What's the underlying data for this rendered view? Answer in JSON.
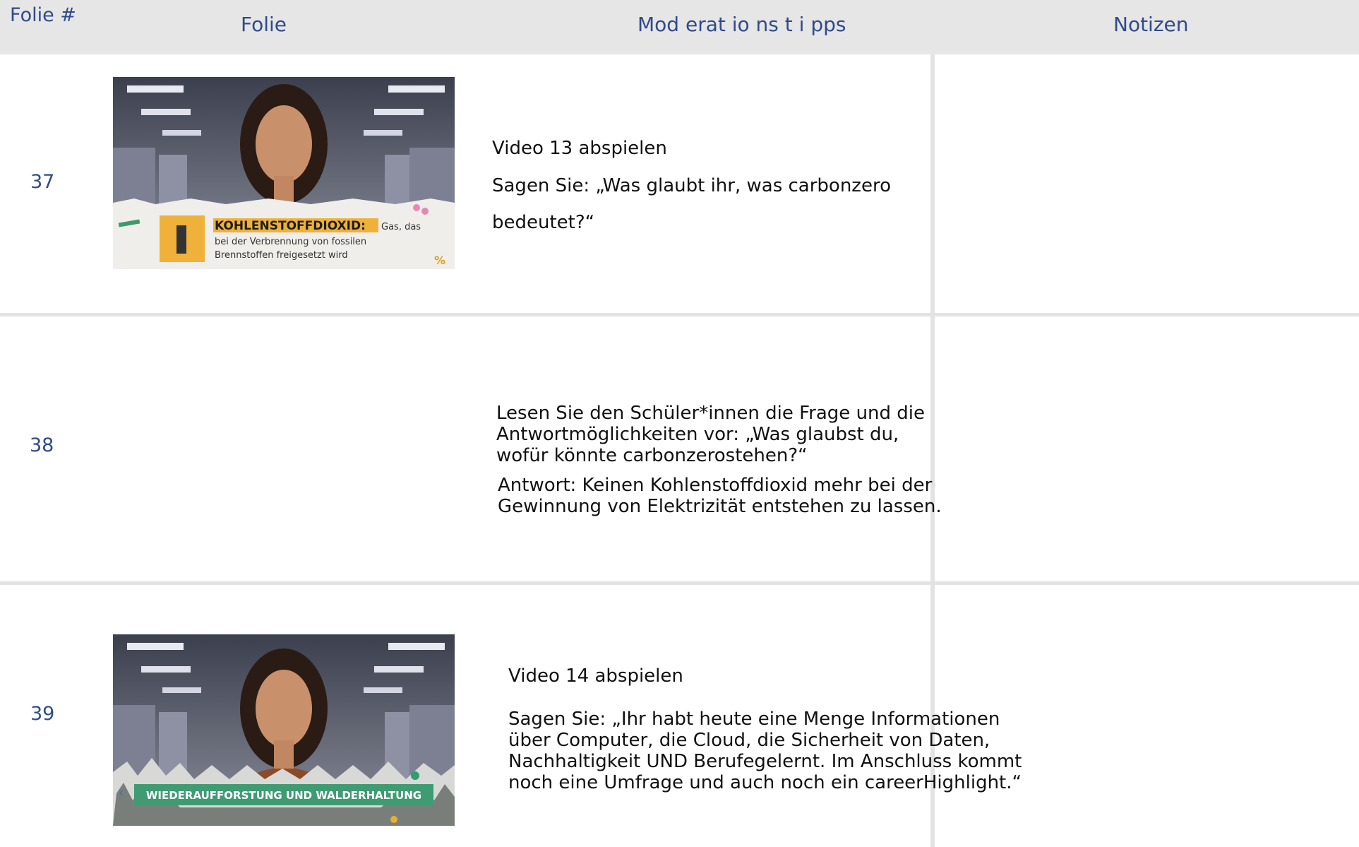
{
  "header": {
    "col_number": "Folie #",
    "col_slide": "Folie",
    "col_tips": "Mod erat io ns t i pps",
    "col_notes": "Notizen"
  },
  "rows": [
    {
      "number": "37",
      "thumbnail": {
        "caption_bold": "KOHLENSTOFFDIOXID:",
        "caption_rest_1": "Gas, das",
        "caption_rest_2": "bei der Verbrennung von fossilen",
        "caption_rest_3": "Brennstoffen freigesetzt wird"
      },
      "line1": "Video 13 abspielen",
      "line2": "Sagen Sie:  „Was glaubt ihr, was carbonzero",
      "line3": "bedeutet?“",
      "notes": ""
    },
    {
      "number": "38",
      "line1": "Lesen Sie den Schüler*innen die Frage und die",
      "line2": "Antwortmöglichkeiten vor: „Was glaubst du,",
      "line3": "wofür könnte carbonzerostehen?“",
      "line4": "Antwort:  Keinen Kohlenstoffdioxid mehr bei der",
      "line5": "Gewinnung von Elektrizität entstehen zu lassen.",
      "notes": ""
    },
    {
      "number": "39",
      "thumbnail": {
        "banner": "WIEDERAUFFORSTUNG UND WALDERHALTUNG"
      },
      "line1": "Video 14 abspielen",
      "line2": "Sagen Sie:  „Ihr habt heute eine Menge Informationen",
      "line3": "über Computer, die Cloud, die Sicherheit von Daten,",
      "line4": "Nachhaltigkeit UND Berufegelernt. Im Anschluss kommt",
      "line5": "noch eine Umfrage und auch noch ein careerHighlight.“",
      "notes": ""
    }
  ]
}
